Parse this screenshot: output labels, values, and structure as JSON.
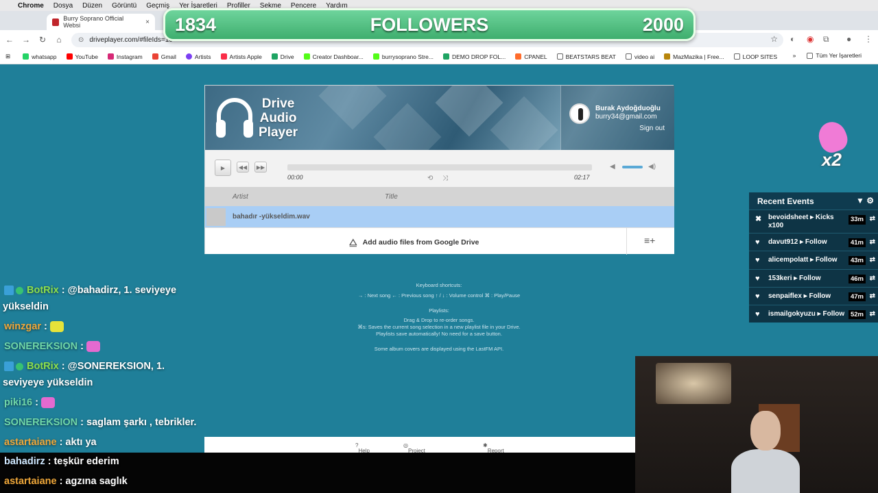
{
  "menubar": {
    "apple": "",
    "items": [
      "Chrome",
      "Dosya",
      "Düzen",
      "Görüntü",
      "Geçmiş",
      "Yer İşaretleri",
      "Profiller",
      "Sekme",
      "Pencere",
      "Yardım"
    ]
  },
  "tabs": [
    {
      "label": "Burry Soprano Official Websi"
    }
  ],
  "address": {
    "url": "driveplayer.com/#fileIds=1c"
  },
  "bookmarks": {
    "items": [
      "whatsapp",
      "YouTube",
      "Instagram",
      "Gmail",
      "Artists",
      "Artists Apple",
      "Drive",
      "Creator Dashboar...",
      "burrysoprano Stre...",
      "DEMO DROP FOL...",
      "CPANEL",
      "BEATSTARS BEAT",
      "video ai",
      "MazMazika | Free...",
      "LOOP SITES"
    ],
    "more": "»",
    "all": "Tüm Yer İşaretleri"
  },
  "goal": {
    "current": "1834",
    "label": "FOLLOWERS",
    "target": "2000"
  },
  "player": {
    "logo": [
      "Drive",
      "Audio",
      "Player"
    ],
    "user_name": "Burak Aydoğduoğlu",
    "user_email": "burry34@gmail.com",
    "signout": "Sign out",
    "time_current": "00:00",
    "time_total": "02:17",
    "col_artist": "Artist",
    "col_title": "Title",
    "track": "bahadır -yükseldim.wav",
    "add_label": "Add audio files from Google Drive"
  },
  "help": {
    "shortcuts_title": "Keyboard shortcuts:",
    "shortcuts": "→ : Next song  ← : Previous song  ↑ / ↓ : Volume control  ⌘ : Play/Pause",
    "playlists_title": "Playlists:",
    "playlists_1": "Drag & Drop to re-order songs.",
    "playlists_2": "⌘s: Saves the current song selection in a new playlist file in your Drive.",
    "playlists_3": "Playlists save automatically! No need for a save button.",
    "lastfm": "Some album covers are displayed using the LastFM API."
  },
  "footer": {
    "help": "Help",
    "github": "Project on GitHub",
    "bug": "Report a bug"
  },
  "chat": [
    {
      "user": "BotRix",
      "text": ": @bahadirz, 1. seviyeye",
      "text2": "yükseldin",
      "color": "#8ee04c"
    },
    {
      "user": "winzgar",
      "text": ":",
      "color": "#f0a83a"
    },
    {
      "user": "SONEREKSION",
      "text": ":",
      "color": "#6fd6a8"
    },
    {
      "user": "BotRix",
      "text": ": @SONEREKSION, 1.",
      "text2": "seviyeye yükseldin",
      "color": "#8ee04c"
    },
    {
      "user": "piki16",
      "text": ":",
      "color": "#6fd6a8"
    },
    {
      "user": "SONEREKSION",
      "text": ": saglam şarkı , tebrikler.",
      "color": "#6fd6a8"
    },
    {
      "user": "astartaiane",
      "text": ": aktı ya",
      "color": "#f0a83a"
    },
    {
      "user": "bahadirz",
      "text": ": teşkür ederim",
      "color": "#cfe8ff"
    },
    {
      "user": "astartaiane",
      "text": ": agzına saglık",
      "color": "#f0a83a"
    }
  ],
  "events": {
    "title": "Recent Events",
    "items": [
      {
        "text": "bevoidsheet ▸ Kicks x100",
        "time": "33m"
      },
      {
        "text": "davut912 ▸ Follow",
        "time": "41m"
      },
      {
        "text": "alicempolatt ▸ Follow",
        "time": "43m"
      },
      {
        "text": "153keri ▸ Follow",
        "time": "46m"
      },
      {
        "text": "senpaiflex ▸ Follow",
        "time": "47m"
      },
      {
        "text": "ismailgokyuzu ▸ Follow",
        "time": "52m"
      }
    ]
  },
  "sticker": {
    "multiplier": "x2"
  }
}
